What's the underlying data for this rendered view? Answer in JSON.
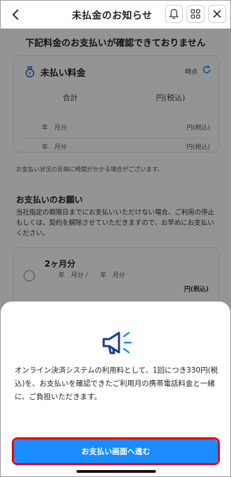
{
  "header": {
    "title": "未払金のお知らせ",
    "back_icon": "chevron-left-icon",
    "bell_icon": "bell-icon",
    "grid_icon": "grid-icon",
    "close_icon": "close-icon"
  },
  "main": {
    "notice_heading": "下記料金のお支払いが確認できておりません",
    "unpaid": {
      "title": "未払い料金",
      "as_of": "時点",
      "total_label": "合計",
      "total_unit": "円(税込)",
      "rows": [
        {
          "label": "年　月分",
          "unit": "円(税込)"
        },
        {
          "label": "年　月分",
          "unit": "円(税込)"
        }
      ]
    },
    "status_note": "お支払い状況の反映に時間がかかる場合がございます。",
    "request_heading": "お支払いのお願い",
    "request_text": "当社指定の期限日までにお支払いいただけない場合、ご利用の停止もしくは、契約を解除させていただきますので、お早めにお支払いください。",
    "option": {
      "label": "2ヶ月分",
      "period": "年　月分 /　　年　月分",
      "unit": "円(税込)"
    }
  },
  "sheet": {
    "icon": "megaphone-icon",
    "text": "オンライン決済システムの利用料として、1回につき330円(税込)を、お支払いを確認できたご利用月の携帯電話料金と一緒に、ご負担いただきます。",
    "proceed_label": "お支払い画面へ進む"
  },
  "colors": {
    "accent": "#1a8cff",
    "highlight": "#e60012",
    "overlay": "rgba(0,0,0,0.42)"
  }
}
